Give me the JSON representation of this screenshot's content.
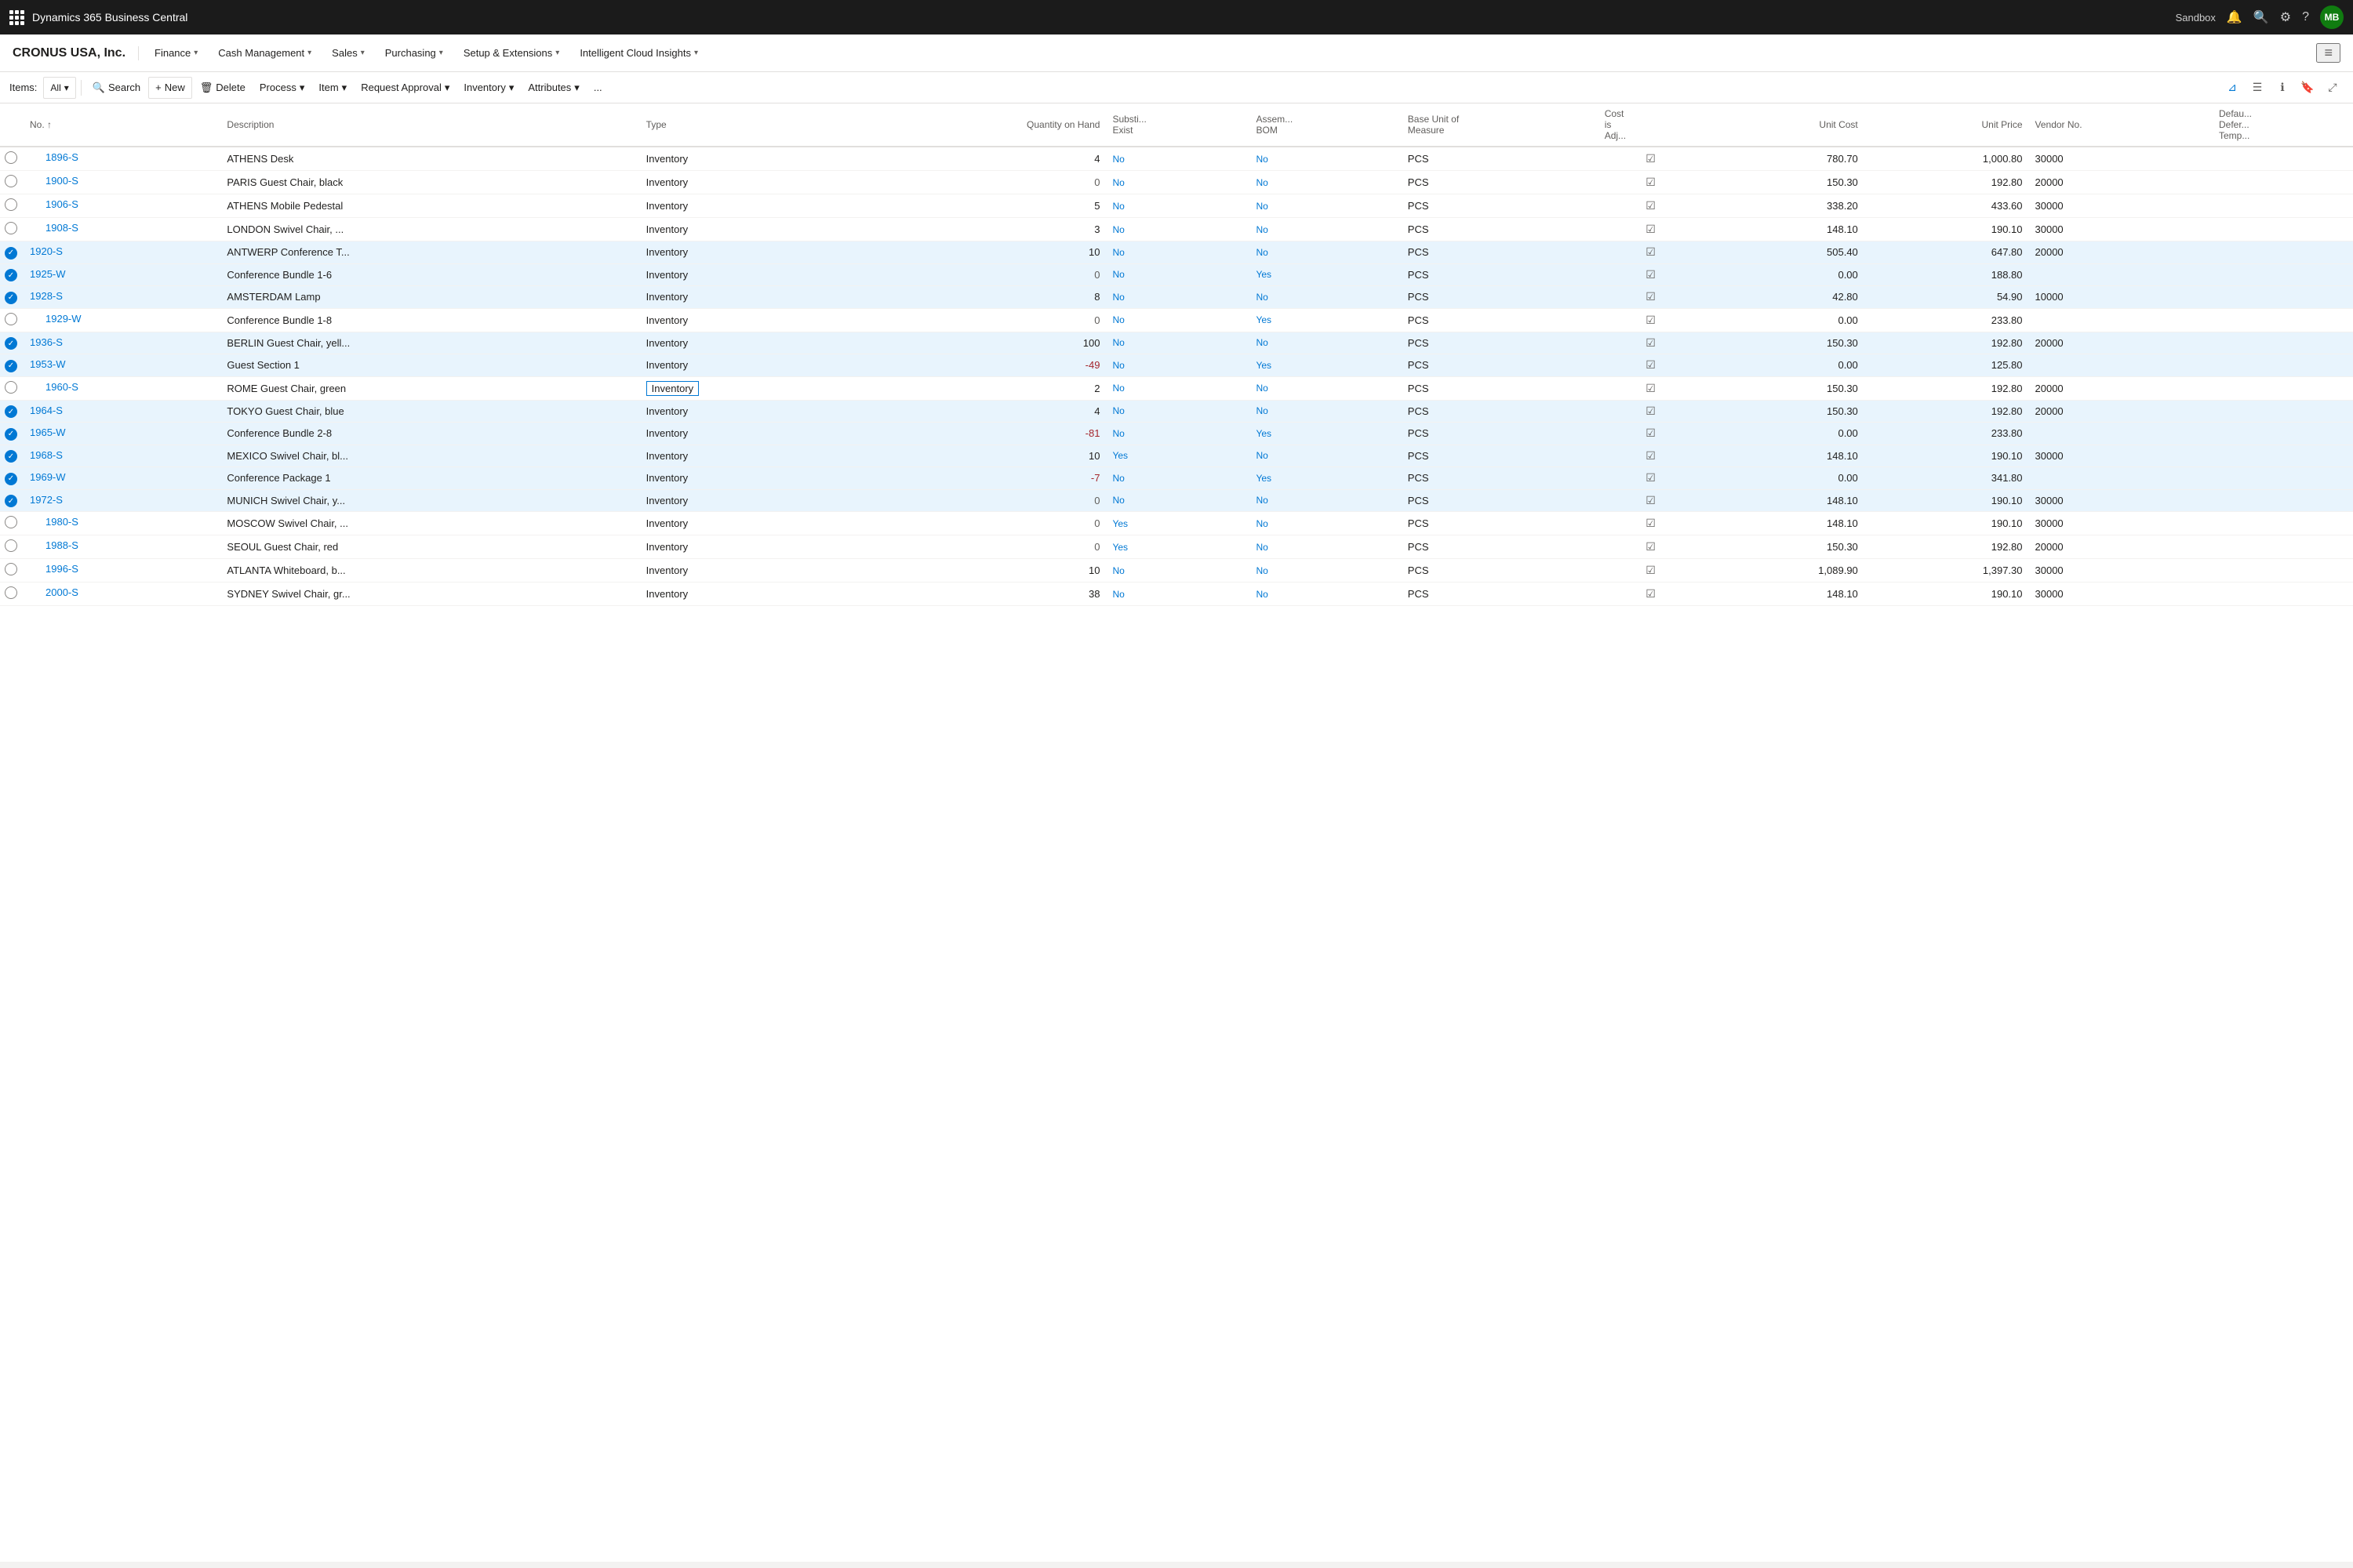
{
  "app": {
    "title": "Dynamics 365 Business Central",
    "sandbox_label": "Sandbox",
    "user_initials": "MB"
  },
  "nav": {
    "company": "CRONUS USA, Inc.",
    "items": [
      {
        "label": "Finance",
        "has_dropdown": true
      },
      {
        "label": "Cash Management",
        "has_dropdown": true
      },
      {
        "label": "Sales",
        "has_dropdown": true
      },
      {
        "label": "Purchasing",
        "has_dropdown": true
      },
      {
        "label": "Setup & Extensions",
        "has_dropdown": true
      },
      {
        "label": "Intelligent Cloud Insights",
        "has_dropdown": true
      }
    ]
  },
  "toolbar": {
    "items_label": "Items:",
    "filter_label": "All",
    "search_label": "Search",
    "new_label": "New",
    "delete_label": "Delete",
    "process_label": "Process",
    "item_label": "Item",
    "request_approval_label": "Request Approval",
    "inventory_label": "Inventory",
    "attributes_label": "Attributes",
    "more_label": "..."
  },
  "columns": [
    {
      "id": "no",
      "label": "No. ↑"
    },
    {
      "id": "description",
      "label": "Description"
    },
    {
      "id": "type",
      "label": "Type"
    },
    {
      "id": "qty",
      "label": "Quantity on Hand"
    },
    {
      "id": "subst",
      "label": "Substi... Exist"
    },
    {
      "id": "assem_bom",
      "label": "Assem... BOM"
    },
    {
      "id": "base_unit",
      "label": "Base Unit of Measure"
    },
    {
      "id": "cost_adj",
      "label": "Cost is Adj..."
    },
    {
      "id": "unit_cost",
      "label": "Unit Cost"
    },
    {
      "id": "unit_price",
      "label": "Unit Price"
    },
    {
      "id": "vendor_no",
      "label": "Vendor No."
    },
    {
      "id": "default_deferred",
      "label": "Defau... Defer... Temp..."
    }
  ],
  "rows": [
    {
      "no": "1896-S",
      "description": "ATHENS Desk",
      "type": "Inventory",
      "qty": 4,
      "subst": "No",
      "assem_bom": "No",
      "base_unit": "PCS",
      "cost_adj": true,
      "unit_cost": "780.70",
      "unit_price": "1,000.80",
      "vendor_no": "30000",
      "selected": false,
      "has_dots": false,
      "cell_border": false
    },
    {
      "no": "1900-S",
      "description": "PARIS Guest Chair, black",
      "type": "Inventory",
      "qty": 0,
      "subst": "No",
      "assem_bom": "No",
      "base_unit": "PCS",
      "cost_adj": true,
      "unit_cost": "150.30",
      "unit_price": "192.80",
      "vendor_no": "20000",
      "selected": false,
      "has_dots": false,
      "cell_border": false
    },
    {
      "no": "1906-S",
      "description": "ATHENS Mobile Pedestal",
      "type": "Inventory",
      "qty": 5,
      "subst": "No",
      "assem_bom": "No",
      "base_unit": "PCS",
      "cost_adj": true,
      "unit_cost": "338.20",
      "unit_price": "433.60",
      "vendor_no": "30000",
      "selected": false,
      "has_dots": false,
      "cell_border": false
    },
    {
      "no": "1908-S",
      "description": "LONDON Swivel Chair, ...",
      "type": "Inventory",
      "qty": 3,
      "subst": "No",
      "assem_bom": "No",
      "base_unit": "PCS",
      "cost_adj": true,
      "unit_cost": "148.10",
      "unit_price": "190.10",
      "vendor_no": "30000",
      "selected": false,
      "has_dots": false,
      "cell_border": false
    },
    {
      "no": "1920-S",
      "description": "ANTWERP Conference T...",
      "type": "Inventory",
      "qty": 10,
      "subst": "No",
      "assem_bom": "No",
      "base_unit": "PCS",
      "cost_adj": true,
      "unit_cost": "505.40",
      "unit_price": "647.80",
      "vendor_no": "20000",
      "selected": true,
      "has_dots": true,
      "cell_border": false
    },
    {
      "no": "1925-W",
      "description": "Conference Bundle 1-6",
      "type": "Inventory",
      "qty": 0,
      "subst": "No",
      "assem_bom": "Yes",
      "base_unit": "PCS",
      "cost_adj": true,
      "unit_cost": "0.00",
      "unit_price": "188.80",
      "vendor_no": "",
      "selected": true,
      "has_dots": true,
      "cell_border": false
    },
    {
      "no": "1928-S",
      "description": "AMSTERDAM Lamp",
      "type": "Inventory",
      "qty": 8,
      "subst": "No",
      "assem_bom": "No",
      "base_unit": "PCS",
      "cost_adj": true,
      "unit_cost": "42.80",
      "unit_price": "54.90",
      "vendor_no": "10000",
      "selected": true,
      "has_dots": true,
      "cell_border": false
    },
    {
      "no": "1929-W",
      "description": "Conference Bundle 1-8",
      "type": "Inventory",
      "qty": 0,
      "subst": "No",
      "assem_bom": "Yes",
      "base_unit": "PCS",
      "cost_adj": true,
      "unit_cost": "0.00",
      "unit_price": "233.80",
      "vendor_no": "",
      "selected": false,
      "has_dots": false,
      "cell_border": false
    },
    {
      "no": "1936-S",
      "description": "BERLIN Guest Chair, yell...",
      "type": "Inventory",
      "qty": 100,
      "subst": "No",
      "assem_bom": "No",
      "base_unit": "PCS",
      "cost_adj": true,
      "unit_cost": "150.30",
      "unit_price": "192.80",
      "vendor_no": "20000",
      "selected": true,
      "has_dots": true,
      "cell_border": false
    },
    {
      "no": "1953-W",
      "description": "Guest Section 1",
      "type": "Inventory",
      "qty": -49,
      "subst": "No",
      "assem_bom": "Yes",
      "base_unit": "PCS",
      "cost_adj": true,
      "unit_cost": "0.00",
      "unit_price": "125.80",
      "vendor_no": "",
      "selected": true,
      "has_dots": true,
      "cell_border": false
    },
    {
      "no": "1960-S",
      "description": "ROME Guest Chair, green",
      "type": "Inventory",
      "qty": 2,
      "subst": "No",
      "assem_bom": "No",
      "base_unit": "PCS",
      "cost_adj": true,
      "unit_cost": "150.30",
      "unit_price": "192.80",
      "vendor_no": "20000",
      "selected": false,
      "has_dots": false,
      "cell_border": true
    },
    {
      "no": "1964-S",
      "description": "TOKYO Guest Chair, blue",
      "type": "Inventory",
      "qty": 4,
      "subst": "No",
      "assem_bom": "No",
      "base_unit": "PCS",
      "cost_adj": true,
      "unit_cost": "150.30",
      "unit_price": "192.80",
      "vendor_no": "20000",
      "selected": true,
      "has_dots": true,
      "cell_border": false
    },
    {
      "no": "1965-W",
      "description": "Conference Bundle 2-8",
      "type": "Inventory",
      "qty": -81,
      "subst": "No",
      "assem_bom": "Yes",
      "base_unit": "PCS",
      "cost_adj": true,
      "unit_cost": "0.00",
      "unit_price": "233.80",
      "vendor_no": "",
      "selected": true,
      "has_dots": true,
      "cell_border": false
    },
    {
      "no": "1968-S",
      "description": "MEXICO Swivel Chair, bl...",
      "type": "Inventory",
      "qty": 10,
      "subst": "Yes",
      "assem_bom": "No",
      "base_unit": "PCS",
      "cost_adj": true,
      "unit_cost": "148.10",
      "unit_price": "190.10",
      "vendor_no": "30000",
      "selected": true,
      "has_dots": true,
      "cell_border": false
    },
    {
      "no": "1969-W",
      "description": "Conference Package 1",
      "type": "Inventory",
      "qty": -7,
      "subst": "No",
      "assem_bom": "Yes",
      "base_unit": "PCS",
      "cost_adj": true,
      "unit_cost": "0.00",
      "unit_price": "341.80",
      "vendor_no": "",
      "selected": true,
      "has_dots": true,
      "cell_border": false
    },
    {
      "no": "1972-S",
      "description": "MUNICH Swivel Chair, y...",
      "type": "Inventory",
      "qty": 0,
      "subst": "No",
      "assem_bom": "No",
      "base_unit": "PCS",
      "cost_adj": true,
      "unit_cost": "148.10",
      "unit_price": "190.10",
      "vendor_no": "30000",
      "selected": true,
      "has_dots": true,
      "cell_border": false
    },
    {
      "no": "1980-S",
      "description": "MOSCOW Swivel Chair, ...",
      "type": "Inventory",
      "qty": 0,
      "subst": "Yes",
      "assem_bom": "No",
      "base_unit": "PCS",
      "cost_adj": true,
      "unit_cost": "148.10",
      "unit_price": "190.10",
      "vendor_no": "30000",
      "selected": false,
      "has_dots": false,
      "cell_border": false
    },
    {
      "no": "1988-S",
      "description": "SEOUL Guest Chair, red",
      "type": "Inventory",
      "qty": 0,
      "subst": "Yes",
      "assem_bom": "No",
      "base_unit": "PCS",
      "cost_adj": true,
      "unit_cost": "150.30",
      "unit_price": "192.80",
      "vendor_no": "20000",
      "selected": false,
      "has_dots": false,
      "cell_border": false
    },
    {
      "no": "1996-S",
      "description": "ATLANTA Whiteboard, b...",
      "type": "Inventory",
      "qty": 10,
      "subst": "No",
      "assem_bom": "No",
      "base_unit": "PCS",
      "cost_adj": true,
      "unit_cost": "1,089.90",
      "unit_price": "1,397.30",
      "vendor_no": "30000",
      "selected": false,
      "has_dots": false,
      "cell_border": false
    },
    {
      "no": "2000-S",
      "description": "SYDNEY Swivel Chair, gr...",
      "type": "Inventory",
      "qty": 38,
      "subst": "No",
      "assem_bom": "No",
      "base_unit": "PCS",
      "cost_adj": true,
      "unit_cost": "148.10",
      "unit_price": "190.10",
      "vendor_no": "30000",
      "selected": false,
      "has_dots": false,
      "cell_border": false
    }
  ]
}
